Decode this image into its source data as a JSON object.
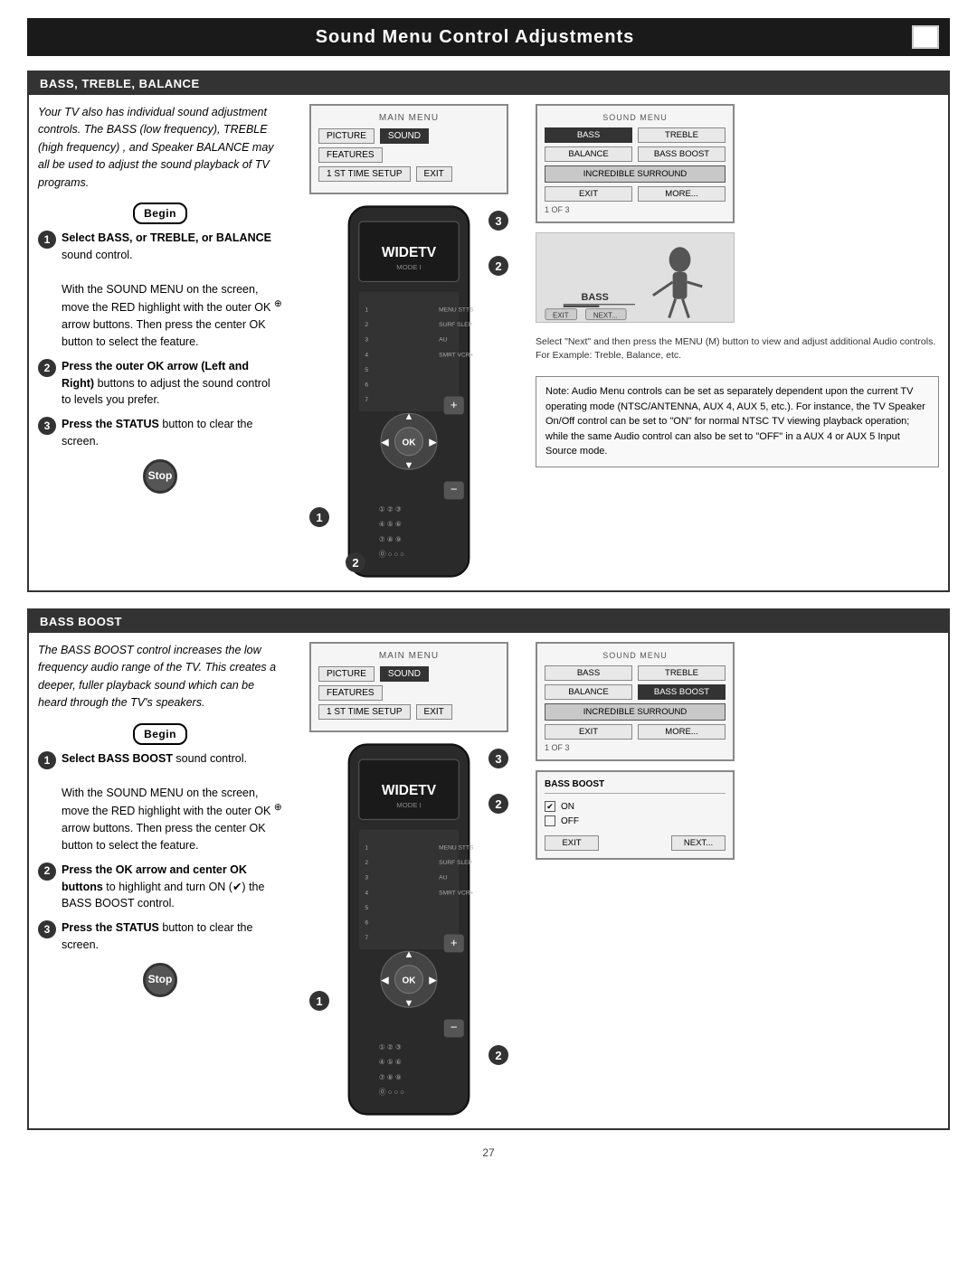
{
  "page": {
    "title": "Sound Menu Control Adjustments",
    "page_number": "27"
  },
  "section1": {
    "header": "Bass, Treble, Balance",
    "intro": "Your TV also has individual sound adjustment controls. The BASS (low frequency), TREBLE (high frequency) , and Speaker BALANCE may all be used to adjust the sound playback of TV programs.",
    "begin_label": "Begin",
    "steps": [
      {
        "num": "1",
        "bold": "Select BASS, or TREBLE, or BALANCE",
        "text": " sound control.\nWith the SOUND MENU on the screen, move the RED highlight with the outer OK arrow buttons. Then press the center OK button to select the feature."
      },
      {
        "num": "2",
        "bold": "Press the outer OK arrow (Left and Right)",
        "text": " buttons to adjust the sound control to levels you prefer."
      },
      {
        "num": "3",
        "bold": "Press the STATUS",
        "text": " button to clear the screen."
      }
    ],
    "stop_label": "Stop",
    "main_menu_title": "MAIN MENU",
    "main_menu_btns": [
      "PICTURE",
      "SOUND",
      "FEATURES",
      "1 ST TIME SETUP",
      "EXIT"
    ],
    "sound_menu_title": "SOUND MENU",
    "sound_menu_items": [
      "BASS",
      "TREBLE",
      "BALANCE",
      "BASS BOOST",
      "INCREDIBLE SURROUND",
      "EXIT",
      "MORE...",
      "1 OF 3"
    ],
    "select_next_caption": "Select \"Next\" and then press the MENU (M) button to view and adjust additional Audio controls. For Example: Treble, Balance, etc.",
    "note_text": "Note: Audio Menu controls can be set as separately dependent upon the current TV operating mode (NTSC/ANTENNA, AUX 4, AUX 5, etc.). For instance, the TV Speaker On/Off control can be set to \"ON\" for normal NTSC TV viewing playback operation; while the same Audio control can also be set to \"OFF\" in a AUX 4 or AUX 5 Input Source mode."
  },
  "section2": {
    "header": "Bass Boost",
    "intro": "The BASS BOOST control increases the low frequency audio range of the TV. This creates a deeper, fuller  playback sound which can be heard through the TV's speakers.",
    "begin_label": "Begin",
    "steps": [
      {
        "num": "1",
        "bold": "Select BASS BOOST",
        "text": " sound control.\nWith the SOUND MENU on the screen, move the RED highlight with the outer OK arrow buttons. Then press the center OK button to select the feature."
      },
      {
        "num": "2",
        "bold": "Press the OK arrow and center OK buttons",
        "text": " to highlight and turn ON (✔) the BASS BOOST control."
      },
      {
        "num": "3",
        "bold": "Press the STATUS",
        "text": " button to clear the screen."
      }
    ],
    "stop_label": "Stop",
    "main_menu_title": "MAIN MENU",
    "main_menu_btns": [
      "PICTURE",
      "SOUND",
      "FEATURES",
      "1 ST TIME SETUP",
      "EXIT"
    ],
    "sound_menu_title": "SOUND MENU",
    "sound_menu_items": [
      "BASS",
      "TREBLE",
      "BALANCE",
      "BASS BOOST",
      "INCREDIBLE SURROUND",
      "EXIT",
      "MORE...",
      "1 OF 3"
    ],
    "bass_boost_label": "BASS BOOST",
    "on_label": "ON",
    "off_label": "OFF",
    "exit_label": "EXIT",
    "next_label": "NEXT..."
  }
}
